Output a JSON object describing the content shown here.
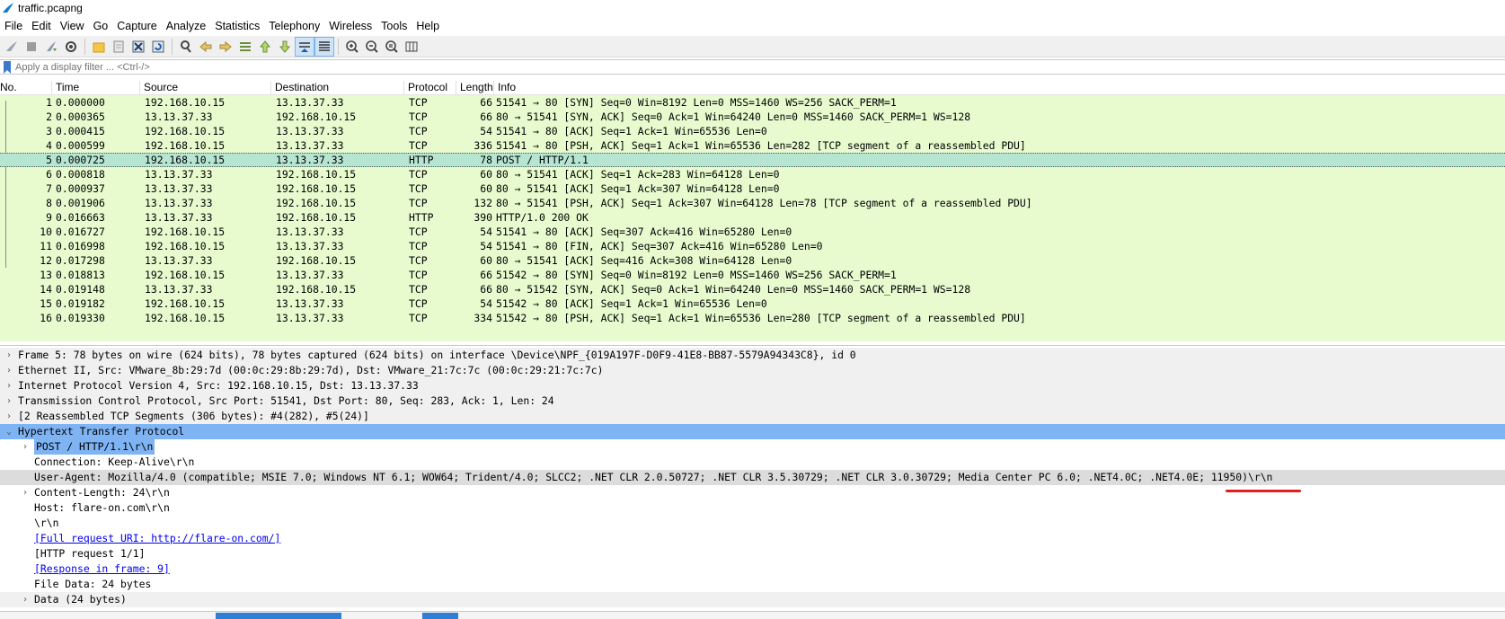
{
  "window": {
    "title": "traffic.pcapng"
  },
  "menu": [
    "File",
    "Edit",
    "View",
    "Go",
    "Capture",
    "Analyze",
    "Statistics",
    "Telephony",
    "Wireless",
    "Tools",
    "Help"
  ],
  "filter": {
    "placeholder": "Apply a display filter ... <Ctrl-/>"
  },
  "columns": {
    "no": "No.",
    "time": "Time",
    "source": "Source",
    "destination": "Destination",
    "protocol": "Protocol",
    "length": "Length",
    "info": "Info"
  },
  "packets": [
    {
      "no": "1",
      "time": "0.000000",
      "src": "192.168.10.15",
      "dst": "13.13.37.33",
      "proto": "TCP",
      "len": "66",
      "info": "51541 → 80 [SYN] Seq=0 Win=8192 Len=0 MSS=1460 WS=256 SACK_PERM=1"
    },
    {
      "no": "2",
      "time": "0.000365",
      "src": "13.13.37.33",
      "dst": "192.168.10.15",
      "proto": "TCP",
      "len": "66",
      "info": "80 → 51541 [SYN, ACK] Seq=0 Ack=1 Win=64240 Len=0 MSS=1460 SACK_PERM=1 WS=128"
    },
    {
      "no": "3",
      "time": "0.000415",
      "src": "192.168.10.15",
      "dst": "13.13.37.33",
      "proto": "TCP",
      "len": "54",
      "info": "51541 → 80 [ACK] Seq=1 Ack=1 Win=65536 Len=0"
    },
    {
      "no": "4",
      "time": "0.000599",
      "src": "192.168.10.15",
      "dst": "13.13.37.33",
      "proto": "TCP",
      "len": "336",
      "info": "51541 → 80 [PSH, ACK] Seq=1 Ack=1 Win=65536 Len=282 [TCP segment of a reassembled PDU]"
    },
    {
      "no": "5",
      "time": "0.000725",
      "src": "192.168.10.15",
      "dst": "13.13.37.33",
      "proto": "HTTP",
      "len": "78",
      "info": "POST / HTTP/1.1"
    },
    {
      "no": "6",
      "time": "0.000818",
      "src": "13.13.37.33",
      "dst": "192.168.10.15",
      "proto": "TCP",
      "len": "60",
      "info": "80 → 51541 [ACK] Seq=1 Ack=283 Win=64128 Len=0"
    },
    {
      "no": "7",
      "time": "0.000937",
      "src": "13.13.37.33",
      "dst": "192.168.10.15",
      "proto": "TCP",
      "len": "60",
      "info": "80 → 51541 [ACK] Seq=1 Ack=307 Win=64128 Len=0"
    },
    {
      "no": "8",
      "time": "0.001906",
      "src": "13.13.37.33",
      "dst": "192.168.10.15",
      "proto": "TCP",
      "len": "132",
      "info": "80 → 51541 [PSH, ACK] Seq=1 Ack=307 Win=64128 Len=78 [TCP segment of a reassembled PDU]"
    },
    {
      "no": "9",
      "time": "0.016663",
      "src": "13.13.37.33",
      "dst": "192.168.10.15",
      "proto": "HTTP",
      "len": "390",
      "info": "HTTP/1.0 200 OK"
    },
    {
      "no": "10",
      "time": "0.016727",
      "src": "192.168.10.15",
      "dst": "13.13.37.33",
      "proto": "TCP",
      "len": "54",
      "info": "51541 → 80 [ACK] Seq=307 Ack=416 Win=65280 Len=0"
    },
    {
      "no": "11",
      "time": "0.016998",
      "src": "192.168.10.15",
      "dst": "13.13.37.33",
      "proto": "TCP",
      "len": "54",
      "info": "51541 → 80 [FIN, ACK] Seq=307 Ack=416 Win=65280 Len=0"
    },
    {
      "no": "12",
      "time": "0.017298",
      "src": "13.13.37.33",
      "dst": "192.168.10.15",
      "proto": "TCP",
      "len": "60",
      "info": "80 → 51541 [ACK] Seq=416 Ack=308 Win=64128 Len=0"
    },
    {
      "no": "13",
      "time": "0.018813",
      "src": "192.168.10.15",
      "dst": "13.13.37.33",
      "proto": "TCP",
      "len": "66",
      "info": "51542 → 80 [SYN] Seq=0 Win=8192 Len=0 MSS=1460 WS=256 SACK_PERM=1"
    },
    {
      "no": "14",
      "time": "0.019148",
      "src": "13.13.37.33",
      "dst": "192.168.10.15",
      "proto": "TCP",
      "len": "66",
      "info": "80 → 51542 [SYN, ACK] Seq=0 Ack=1 Win=64240 Len=0 MSS=1460 SACK_PERM=1 WS=128"
    },
    {
      "no": "15",
      "time": "0.019182",
      "src": "192.168.10.15",
      "dst": "13.13.37.33",
      "proto": "TCP",
      "len": "54",
      "info": "51542 → 80 [ACK] Seq=1 Ack=1 Win=65536 Len=0"
    },
    {
      "no": "16",
      "time": "0.019330",
      "src": "192.168.10.15",
      "dst": "13.13.37.33",
      "proto": "TCP",
      "len": "334",
      "info": "51542 → 80 [PSH, ACK] Seq=1 Ack=1 Win=65536 Len=280 [TCP segment of a reassembled PDU]"
    }
  ],
  "details": [
    {
      "text": "Frame 5: 78 bytes on wire (624 bits), 78 bytes captured (624 bits) on interface \\Device\\NPF_{019A197F-D0F9-41E8-BB87-5579A94343C8}, id 0"
    },
    {
      "text": "Ethernet II, Src: VMware_8b:29:7d (00:0c:29:8b:29:7d), Dst: VMware_21:7c:7c (00:0c:29:21:7c:7c)"
    },
    {
      "text": "Internet Protocol Version 4, Src: 192.168.10.15, Dst: 13.13.37.33"
    },
    {
      "text": "Transmission Control Protocol, Src Port: 51541, Dst Port: 80, Seq: 283, Ack: 1, Len: 24"
    },
    {
      "text": "[2 Reassembled TCP Segments (306 bytes): #4(282), #5(24)]"
    },
    {
      "text": "Hypertext Transfer Protocol"
    },
    {
      "text": "POST / HTTP/1.1\\r\\n"
    },
    {
      "text": "Connection: Keep-Alive\\r\\n"
    },
    {
      "text": "User-Agent: Mozilla/4.0 (compatible; MSIE 7.0; Windows NT 6.1; WOW64; Trident/4.0; SLCC2; .NET CLR 2.0.50727; .NET CLR 3.5.30729; .NET CLR 3.0.30729; Media Center PC 6.0; .NET4.0C; .NET4.0E; 11950)\\r\\n"
    },
    {
      "text": "Content-Length: 24\\r\\n"
    },
    {
      "text": "Host: flare-on.com\\r\\n"
    },
    {
      "text": "\\r\\n"
    },
    {
      "text": "[Full request URI: http://flare-on.com/]"
    },
    {
      "text": "[HTTP request 1/1]"
    },
    {
      "text": "[Response in frame: 9]"
    },
    {
      "text": "File Data: 24 bytes"
    },
    {
      "text": "Data (24 bytes)"
    }
  ],
  "colors": {
    "tcp_row": "#e7fbcf",
    "selected_row": "#b6e6d2",
    "detail_selected": "#7fb4f4",
    "annotation": "#e31e1e"
  }
}
